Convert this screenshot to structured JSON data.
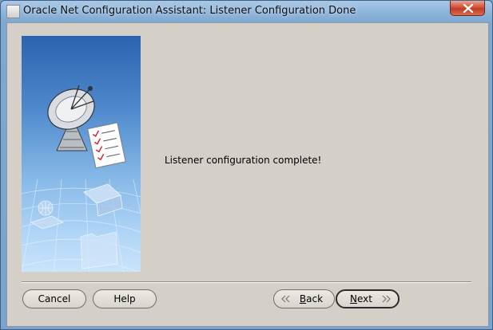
{
  "window": {
    "title": "Oracle Net Configuration Assistant: Listener Configuration Done"
  },
  "main": {
    "message": "Listener configuration complete!"
  },
  "buttons": {
    "cancel": "Cancel",
    "help": "Help",
    "back_mnemonic": "B",
    "back_rest": "ack",
    "next_mnemonic": "N",
    "next_rest": "ext"
  },
  "icons": {
    "app": "app-icon",
    "close": "close-icon",
    "back": "double-chevron-left-icon",
    "next": "double-chevron-right-icon"
  }
}
